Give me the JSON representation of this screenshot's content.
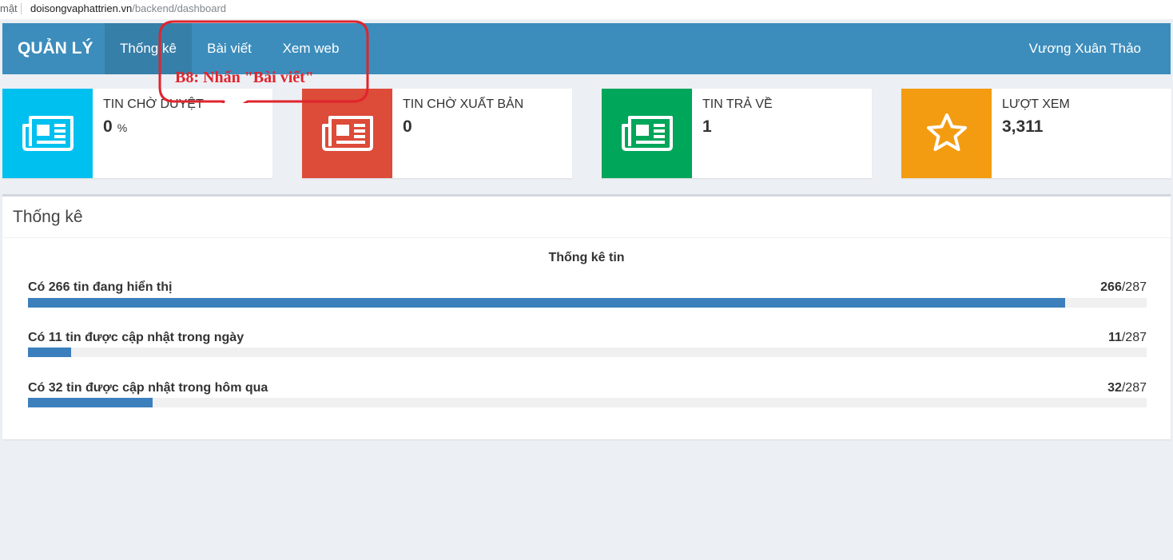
{
  "browser": {
    "security_label": "mật",
    "url_host": "doisongvaphattrien.vn",
    "url_path": "/backend/dashboard"
  },
  "navbar": {
    "brand": "QUẢN LÝ",
    "items": [
      {
        "label": "Thống kê",
        "active": true
      },
      {
        "label": "Bài viết",
        "active": false
      },
      {
        "label": "Xem web",
        "active": false
      }
    ],
    "user": "Vương Xuân Thảo",
    "color": "#3c8dbc"
  },
  "info_boxes": [
    {
      "label": "TIN CHỜ DUYỆT",
      "value": "0",
      "unit": "%",
      "icon": "newspaper-icon",
      "color": "#00c0ef"
    },
    {
      "label": "TIN CHỜ XUẤT BẢN",
      "value": "0",
      "unit": "",
      "icon": "newspaper-icon",
      "color": "#dd4b39"
    },
    {
      "label": "TIN TRẢ VỀ",
      "value": "1",
      "unit": "",
      "icon": "newspaper-icon",
      "color": "#00a65a"
    },
    {
      "label": "LƯỢT XEM",
      "value": "3,311",
      "unit": "",
      "icon": "star-icon",
      "color": "#f39c12"
    }
  ],
  "stats_panel": {
    "title": "Thống kê",
    "chart_heading": "Thống kê tin",
    "progress": [
      {
        "label": "Có 266 tin đang hiển thị",
        "value": 266,
        "total": 287,
        "count": "266",
        "total_text": "/287"
      },
      {
        "label": "Có 11 tin được cập nhật trong ngày",
        "value": 11,
        "total": 287,
        "count": "11",
        "total_text": "/287"
      },
      {
        "label": "Có 32 tin được cập nhật trong hôm qua",
        "value": 32,
        "total": 287,
        "count": "32",
        "total_text": "/287"
      }
    ],
    "bar_color": "#3c7fbd"
  },
  "annotation": {
    "text": "B8: Nhấn \"Bài viết\"",
    "color": "#e0242c"
  }
}
